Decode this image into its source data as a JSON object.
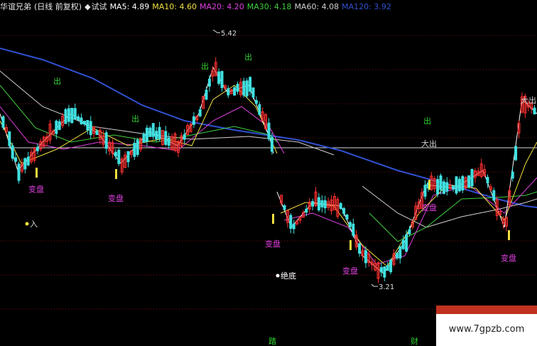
{
  "header": {
    "stock_name": "华谊兄弟",
    "period": "(日线 前复权)",
    "indicator_dot": "◆",
    "indicator_name": "试试",
    "ma5": "MA5: 4.89",
    "ma10": "MA10: 4.60",
    "ma20": "MA20: 4.20",
    "ma30": "MA30: 4.18",
    "ma60": "MA60: 4.08",
    "ma120": "MA120: 3.92"
  },
  "colors": {
    "background": "#000000",
    "stock_name": "#e8e8e8",
    "ma5": "#ffffff",
    "ma10": "#f0e040",
    "ma20": "#e040e0",
    "ma30": "#40d040",
    "ma60": "#d0d0d0",
    "ma120": "#3050d0",
    "grid": "#7a1010",
    "up": "#ff3030",
    "down": "#40e0e0",
    "signal_green": "#30d030",
    "signal_magenta": "#e040e0",
    "marker_yellow": "#f0e040"
  },
  "annotations": {
    "peak_label": "5.42",
    "low_label": "3.21",
    "ru_label": "入",
    "juedi_label": "绝底",
    "bottom_label_1": "踏",
    "bottom_label_2": "财"
  },
  "signals": {
    "chu": "出",
    "bianpan": "变盘",
    "dachu": "大出"
  },
  "watermark": {
    "text": "www.7gpzb.com"
  }
}
